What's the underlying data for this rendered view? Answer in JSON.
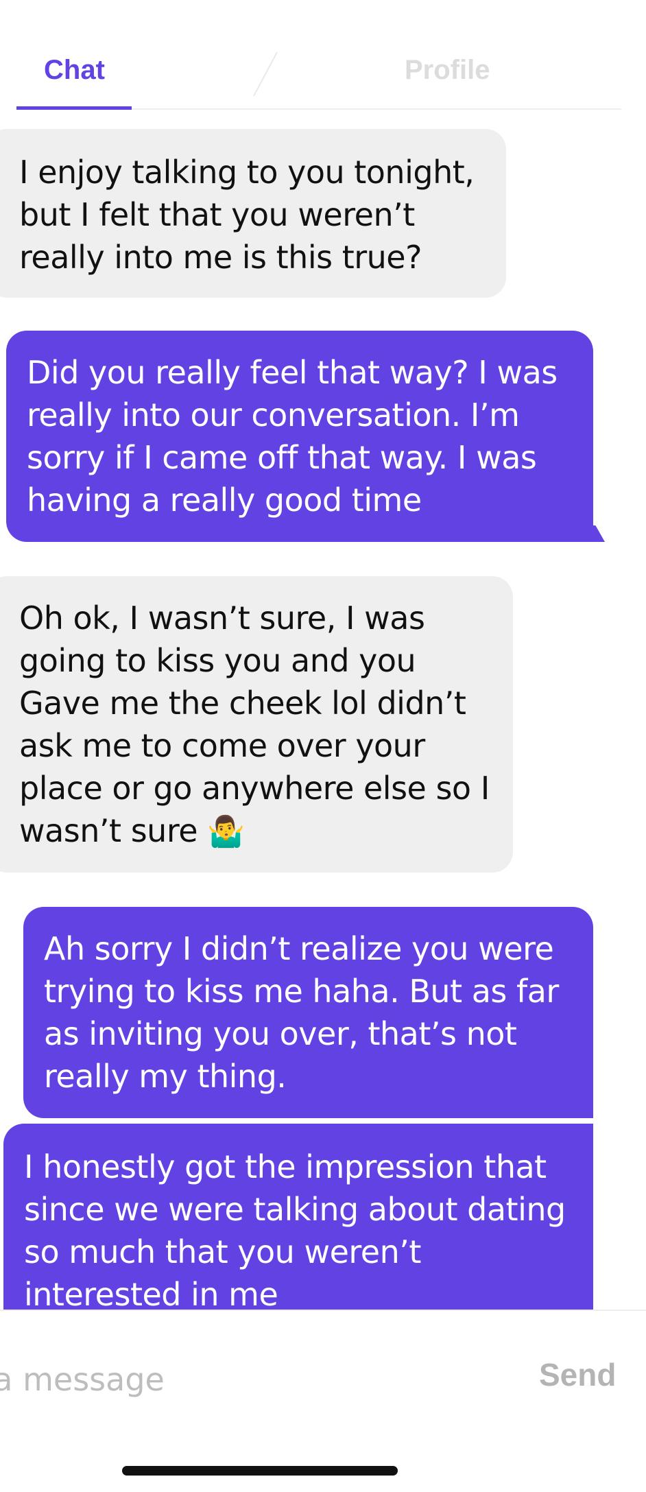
{
  "colors": {
    "accent": "#6342E3",
    "received_bubble": "#EFEFEF"
  },
  "tabs": [
    {
      "label": "Chat",
      "active": true
    },
    {
      "label": "Profile",
      "active": false
    }
  ],
  "messages": [
    {
      "direction": "received",
      "text": "I enjoy talking to you tonight, but I felt that you weren’t really into me is this true?"
    },
    {
      "direction": "sent",
      "text": "Did you really feel that way? I was really into our conversation. I’m sorry if I came off that way. I was having a really good time"
    },
    {
      "direction": "received",
      "text": "Oh ok, I wasn’t sure, I was going to kiss you and you Gave me the cheek lol didn’t ask me to come over your place or go anywhere else so I wasn’t sure",
      "emoji": "🤷‍♂️"
    },
    {
      "direction": "sent",
      "text": "Ah sorry I didn’t realize you were trying to kiss me haha. But as far as inviting you over, that’s not really my thing."
    },
    {
      "direction": "sent",
      "text": "I honestly got the impression that since we were talking about dating so much that you weren’t interested in me"
    }
  ],
  "composer": {
    "placeholder": "Type a message",
    "send_label": "Send"
  },
  "icons": {
    "home_indicator": "home-indicator-bar"
  }
}
